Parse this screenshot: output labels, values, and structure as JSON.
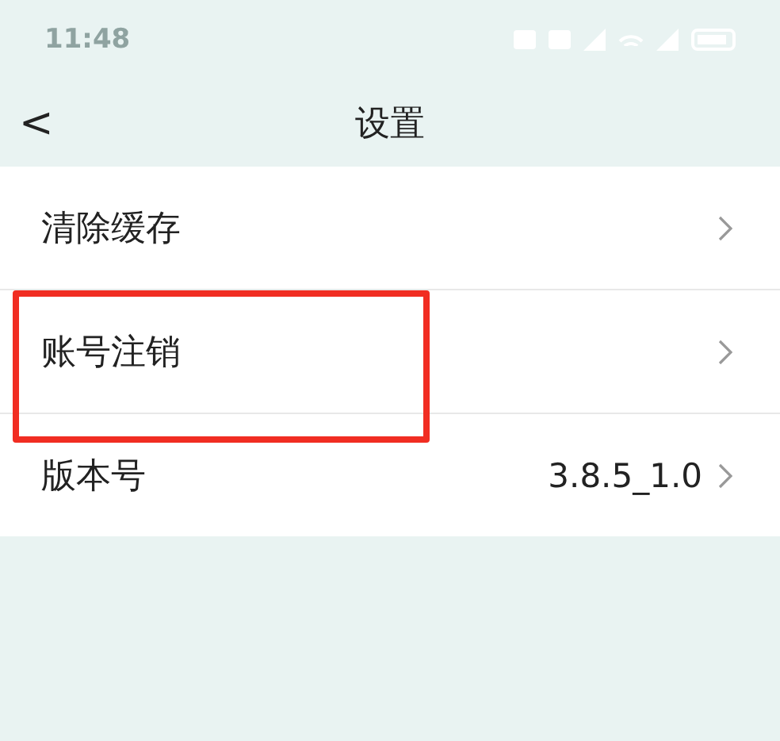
{
  "status_bar": {
    "time": "11:48"
  },
  "header": {
    "back_icon": "<",
    "title": "设置"
  },
  "rows": [
    {
      "label": "清除缓存",
      "highlighted": false
    },
    {
      "label": "账号注销",
      "highlighted": true
    },
    {
      "label": "版本号",
      "value": "3.8.5_1.0",
      "highlighted": false
    }
  ]
}
